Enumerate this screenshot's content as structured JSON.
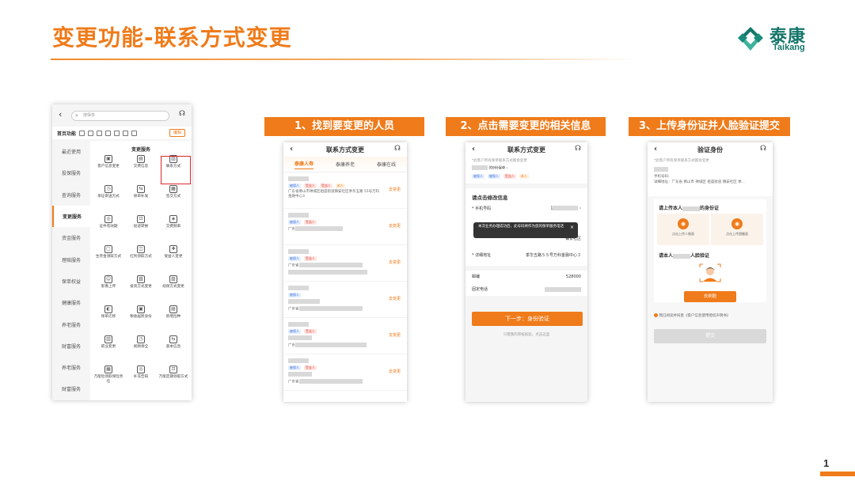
{
  "slide": {
    "title": "变更功能-联系方式变更",
    "page_number": "1",
    "logo": {
      "cn": "泰康",
      "en": "Taikang"
    },
    "accent_color": "#ef7b1a"
  },
  "steps": [
    {
      "label": "1、找到要变更的人员"
    },
    {
      "label": "2、点击需要变更的相关信息"
    },
    {
      "label": "3、上传身份证并人脸验证提交"
    }
  ],
  "phone1": {
    "search_placeholder": "搜保单",
    "func_label": "首页功能",
    "edit_label": "编辑",
    "sidebar": [
      "最近使用",
      "投保服务",
      "查询服务",
      "变更服务",
      "资金服务",
      "理赔服务",
      "保单权益",
      "健康服务",
      "养老服务",
      "财富服务",
      "养老服务",
      "财富服务"
    ],
    "grid_title": "变更服务",
    "grid": [
      [
        "客户信息变更",
        "交费信息",
        "联系方式"
      ],
      [
        "单证寄送方式",
        "保单补发",
        "签交方式"
      ],
      [
        "证件有效期",
        "投退转换",
        "交费频率"
      ],
      [
        "生存金领取方式",
        "红利领取方式",
        "受益人变更"
      ],
      [
        "影像上传",
        "投资方式变更",
        "续保方式变更"
      ],
      [
        "保单迁移",
        "税收居民身份",
        "新增险种"
      ],
      [
        "职业变更",
        "视频保全",
        "基本信息"
      ],
      [
        "万能险领取保险责任",
        "补充告知",
        "万能定期领取方式"
      ]
    ]
  },
  "phone2": {
    "title": "联系方式变更",
    "tabs": [
      "泰康人寿",
      "泰康养老",
      "泰康在线"
    ],
    "tags": {
      "insured": "被保人",
      "beneficiary": "受益人",
      "self": "本人"
    },
    "first_address": "广东省佛山市禅城区祖庙街道镇安社区季华五路 55号万科金融中心3",
    "addr_prefix_1": "广东",
    "addr_prefix_2": "广东省",
    "link": "去变更"
  },
  "phone3": {
    "title": "联系方式变更",
    "notice": "*此客户所有保单联系方式都会变更",
    "policy_suffix": "的9份保单",
    "section_title": "请点击修改信息",
    "phone_label": "* 手机号码",
    "phone_value": "1",
    "toast": "本次业务办理成功后，此号码将作为您的保单服务电话",
    "address_suffix": "镇安社区",
    "detail_label": "* 详细地址",
    "detail_value": "季华五路５５号万科金融中心３",
    "zip_label": "邮编",
    "zip_value": "528000",
    "landline_label": "固定电话",
    "next_button": "下一步：身份验证",
    "footer_link": "只需我的审核核验，点击这里"
  },
  "phone4": {
    "title": "验证身份",
    "notice": "*此客户所有保单联系方式都会变更",
    "phone_line": "手机号码:",
    "addr_line": "详细地址：广东省 佛山市 禅城区 祖庙街道 镇安社区 季...",
    "upload_prefix": "请上传本人",
    "upload_suffix": "的身份证",
    "front_label": "点击上传人像面",
    "back_label": "点击上传国徽面",
    "face_prefix": "请本人",
    "face_suffix": "人脸验证",
    "face_button": "去刷脸",
    "agree_text": "我已阅读并同意《客户信息使用授权声明书》",
    "submit_button": "提交"
  }
}
